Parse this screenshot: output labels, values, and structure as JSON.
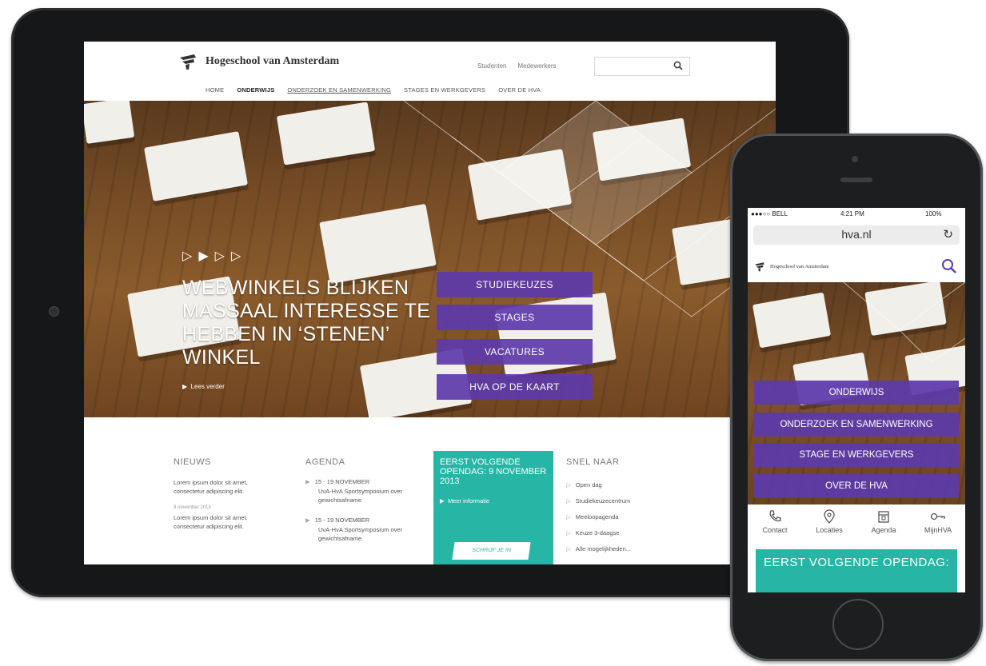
{
  "ipad_site": {
    "logo_text": "Hogeschool van Amsterdam",
    "top_links": [
      "Studenten",
      "Medewerkers"
    ],
    "nav": [
      "HOME",
      "ONDERWIJS",
      "ONDERZOEK EN SAMENWERKING",
      "STAGES EN WERKGEVERS",
      "OVER DE HVA"
    ],
    "hero": {
      "headline": "WEBWINKELS BLIJKEN MASSAAL INTERESSE TE HEBBEN IN ‘STENEN’ WINKEL",
      "read_more": "Lees verder",
      "buttons": [
        "STUDIEKEUZES",
        "STAGES",
        "VACATURES",
        "HVA OP DE KAART"
      ]
    },
    "nieuws": {
      "title": "NIEUWS",
      "item1": "Lorem ipsum dolor sit amet, consectetur adipiscing elit.",
      "item1_date": "9 november 2013",
      "item2": "Lorem ipsum dolor sit amet, consectetur adipiscing elit."
    },
    "agenda": {
      "title": "AGENDA",
      "item1_date": "15 - 19 NOVEMBER",
      "item1_text": "UvA-HvA Sportsymposium over gewichtsafname",
      "item2_date": "15 - 19 NOVEMBER",
      "item2_text": "UvA-HvA Sportsymposium over gewichtsafname"
    },
    "opendag": {
      "title": "EERST VOLGENDE OPENDAG: 9 NOVEMBER 2013",
      "more": "Meer informatie",
      "button": "SCHRIJF JE IN"
    },
    "snel_naar": {
      "title": "SNEL NAAR",
      "items": [
        "Open dag",
        "Studiekeuzecentrum",
        "Meeloopagenda",
        "Keuze 3-daagse",
        "Alle mogelijkheden..."
      ]
    }
  },
  "iphone_site": {
    "status_carrier": "●●●○○ BELL",
    "status_time": "4:21 PM",
    "status_battery": "100%",
    "url": "hva.nl",
    "logo_text": "Hogeschool van Amsterdam",
    "buttons": [
      "ONDERWIJS",
      "ONDERZOEK EN SAMENWERKING",
      "STAGE EN WERKGEVERS",
      "OVER DE HVA"
    ],
    "quick_links": [
      "Contact",
      "Locaties",
      "Agenda",
      "MijnHVA"
    ],
    "opendag_title": "EERST VOLGENDE OPENDAG:"
  },
  "colors": {
    "purple": "#5d3aaa",
    "teal": "#27b6a5",
    "device": "#161718"
  }
}
